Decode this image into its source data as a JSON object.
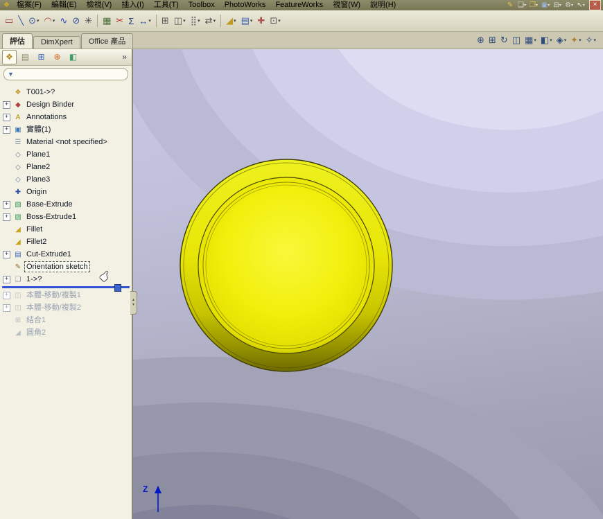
{
  "window": {
    "close_glyph": "×"
  },
  "menubar": {
    "app_icon": {
      "name": "app-icon",
      "glyph": "❖",
      "color": "#d8b020"
    },
    "items": [
      {
        "key": "file",
        "label": "檔案(F)"
      },
      {
        "key": "edit",
        "label": "編輯(E)"
      },
      {
        "key": "view",
        "label": "檢視(V)"
      },
      {
        "key": "insert",
        "label": "插入(I)"
      },
      {
        "key": "tools",
        "label": "工具(T)"
      },
      {
        "key": "toolbox",
        "label": "Toolbox"
      },
      {
        "key": "photoworks",
        "label": "PhotoWorks"
      },
      {
        "key": "featureworks",
        "label": "FeatureWorks"
      },
      {
        "key": "window",
        "label": "視窗(W)"
      },
      {
        "key": "help",
        "label": "說明(H)"
      }
    ],
    "quick_icons": [
      {
        "name": "edit-color-icon",
        "glyph": "✎",
        "color": "#e6c84a"
      },
      {
        "name": "new-document-icon",
        "glyph": "❏",
        "color": "#eceadc",
        "dropdown": true
      },
      {
        "name": "open-document-icon",
        "glyph": "❐",
        "color": "#e0c040",
        "dropdown": true
      },
      {
        "name": "save-icon",
        "glyph": "▣",
        "color": "#9db4e0",
        "dropdown": true
      },
      {
        "name": "print-icon",
        "glyph": "⊟",
        "color": "#dcdcd2",
        "dropdown": true
      },
      {
        "name": "options-icon",
        "glyph": "⚙",
        "color": "#dcdcd2",
        "dropdown": true
      },
      {
        "name": "select-tool-icon",
        "glyph": "↖",
        "color": "#eceadc",
        "dropdown": true
      }
    ]
  },
  "toolbar": {
    "icons": [
      {
        "name": "sketch-rectangle-icon",
        "glyph": "▭",
        "color": "#a23a2e"
      },
      {
        "name": "sketch-line-icon",
        "glyph": "╲",
        "color": "#32529e"
      },
      {
        "name": "sketch-circle-icon",
        "glyph": "⊙",
        "color": "#32529e",
        "dropdown": true
      },
      {
        "name": "sketch-arc-icon",
        "glyph": "◠",
        "color": "#a23a2e",
        "dropdown": true
      },
      {
        "name": "sketch-spline-icon",
        "glyph": "∿",
        "color": "#2545b8"
      },
      {
        "name": "sketch-ellipse-icon",
        "glyph": "⊘",
        "color": "#32529e"
      },
      {
        "name": "sketch-point-icon",
        "glyph": "✳",
        "color": "#404040"
      },
      {
        "sep": true
      },
      {
        "name": "convert-entities-icon",
        "glyph": "▦",
        "color": "#4a6a3a"
      },
      {
        "name": "trim-entities-icon",
        "glyph": "✂",
        "color": "#b02424"
      },
      {
        "name": "equations-icon",
        "glyph": "Σ",
        "color": "#1e3a78"
      },
      {
        "name": "smart-dimension-icon",
        "glyph": "↔",
        "color": "#32529e",
        "dropdown": true
      },
      {
        "sep": true
      },
      {
        "name": "offset-entities-icon",
        "glyph": "⊞",
        "color": "#555555"
      },
      {
        "name": "mirror-entities-icon",
        "glyph": "◫",
        "color": "#555555",
        "dropdown": true
      },
      {
        "name": "linear-pattern-icon",
        "glyph": "⣿",
        "color": "#666666",
        "dropdown": true
      },
      {
        "name": "move-entities-icon",
        "glyph": "⇄",
        "color": "#555555",
        "dropdown": true
      },
      {
        "sep": true
      },
      {
        "name": "sketch-fillet-icon",
        "glyph": "◢",
        "color": "#c09a20",
        "dropdown": true
      },
      {
        "name": "display-relations-icon",
        "glyph": "▤",
        "color": "#3a62b8",
        "dropdown": true
      },
      {
        "name": "repair-sketch-icon",
        "glyph": "✚",
        "color": "#b05050"
      },
      {
        "name": "grid-settings-icon",
        "glyph": "⊡",
        "color": "#555555",
        "dropdown": true
      }
    ]
  },
  "tabs": {
    "items": [
      {
        "key": "evaluate",
        "label": "評估",
        "active": true
      },
      {
        "key": "dimxpert",
        "label": "DimXpert"
      },
      {
        "key": "office-products",
        "label": "Office 產品"
      }
    ]
  },
  "headsup": {
    "icons": [
      {
        "name": "zoom-fit-icon",
        "glyph": "⊕",
        "color": "#2c4a7c"
      },
      {
        "name": "zoom-area-icon",
        "glyph": "⊞",
        "color": "#2c4a7c"
      },
      {
        "name": "previous-view-icon",
        "glyph": "↻",
        "color": "#2c4a7c"
      },
      {
        "name": "section-view-icon",
        "glyph": "◫",
        "color": "#2c4a7c"
      },
      {
        "name": "view-orientation-icon",
        "glyph": "▦",
        "color": "#2c4a7c",
        "dropdown": true
      },
      {
        "name": "display-style-icon",
        "glyph": "◧",
        "color": "#2c4a7c",
        "dropdown": true
      },
      {
        "name": "hide-show-items-icon",
        "glyph": "◈",
        "color": "#2c4a7c",
        "dropdown": true
      },
      {
        "name": "appearances-icon",
        "glyph": "✦",
        "color": "#b08030",
        "dropdown": true
      },
      {
        "name": "scene-icon",
        "glyph": "✧",
        "color": "#2c4a7c",
        "dropdown": true
      }
    ]
  },
  "panel": {
    "overflow_glyph": "»",
    "filter_glyph": "▼",
    "hand_glyph": "☛",
    "header_icons": [
      {
        "name": "featuremanager-tree-icon",
        "glyph": "❖",
        "color": "#b08820",
        "active": true
      },
      {
        "name": "propertymanager-icon",
        "glyph": "▤",
        "color": "#8a8a6a"
      },
      {
        "name": "configurationmanager-icon",
        "glyph": "⊞",
        "color": "#3a62b8"
      },
      {
        "name": "dimxpertmanager-icon",
        "glyph": "⊕",
        "color": "#d07020"
      },
      {
        "name": "displaymanager-icon",
        "glyph": "◧",
        "color": "#3a9a6a"
      }
    ],
    "tree": [
      {
        "key": "part-root",
        "label": "T001->?",
        "icon": "part-icon",
        "glyph": "❖",
        "color": "#c09020"
      },
      {
        "key": "design-binder",
        "label": "Design Binder",
        "icon": "design-binder-icon",
        "glyph": "◆",
        "color": "#b04040",
        "expand": true
      },
      {
        "key": "annotations",
        "label": "Annotations",
        "icon": "annotations-icon",
        "glyph": "A",
        "color": "#b08c00",
        "expand": true
      },
      {
        "key": "solid-bodies",
        "label": "實體(1)",
        "icon": "solid-bodies-folder-icon",
        "glyph": "▣",
        "color": "#3a7ab8",
        "expand": true
      },
      {
        "key": "material",
        "label": "Material <not specified>",
        "icon": "material-icon",
        "glyph": "☰",
        "color": "#7a8ca0"
      },
      {
        "key": "plane1",
        "label": "Plane1",
        "icon": "plane-icon",
        "glyph": "◇",
        "color": "#60788e"
      },
      {
        "key": "plane2",
        "label": "Plane2",
        "icon": "plane-icon",
        "glyph": "◇",
        "color": "#60788e"
      },
      {
        "key": "plane3",
        "label": "Plane3",
        "icon": "plane-icon",
        "glyph": "◇",
        "color": "#60788e"
      },
      {
        "key": "origin",
        "label": "Origin",
        "icon": "origin-icon",
        "glyph": "✚",
        "color": "#3050b0"
      },
      {
        "key": "base-extrude",
        "label": "Base-Extrude",
        "icon": "extrude-feature-icon",
        "glyph": "▧",
        "color": "#3a9a5a",
        "expand": true
      },
      {
        "key": "boss-extrude1",
        "label": "Boss-Extrude1",
        "icon": "extrude-feature-icon",
        "glyph": "▧",
        "color": "#3a9a5a",
        "expand": true
      },
      {
        "key": "fillet",
        "label": "Fillet",
        "icon": "fillet-feature-icon",
        "glyph": "◢",
        "color": "#c9a21d"
      },
      {
        "key": "fillet2",
        "label": "Fillet2",
        "icon": "fillet-feature-icon",
        "glyph": "◢",
        "color": "#c9a21d"
      },
      {
        "key": "cut-extrude1",
        "label": "Cut-Extrude1",
        "icon": "cut-extrude-feature-icon",
        "glyph": "▤",
        "color": "#3a62b8",
        "expand": true
      },
      {
        "key": "orientation-sketch",
        "label": "Orientation sketch",
        "icon": "sketch-icon",
        "glyph": "✎",
        "color": "#8a6a30",
        "selected": true
      },
      {
        "key": "derived-part",
        "label": "1->?",
        "icon": "derived-part-icon",
        "glyph": "❏",
        "color": "#8894a4",
        "expand": true,
        "rollback_after": true
      },
      {
        "key": "move-copy-body1",
        "label": "本體-移動/複製1",
        "icon": "move-copy-body-icon",
        "glyph": "◫",
        "color": "#8898a8",
        "expand": true,
        "grayed": true
      },
      {
        "key": "move-copy-body2",
        "label": "本體-移動/複製2",
        "icon": "move-copy-body-icon",
        "glyph": "◫",
        "color": "#8898a8",
        "expand": true,
        "grayed": true
      },
      {
        "key": "combine1",
        "label": "結合1",
        "icon": "combine-feature-icon",
        "glyph": "⊞",
        "color": "#8898a8",
        "grayed": true
      },
      {
        "key": "fillet-round2",
        "label": "圓角2",
        "icon": "fillet-feature-icon",
        "glyph": "◢",
        "color": "#8898a8",
        "grayed": true
      }
    ]
  },
  "viewport": {
    "triad_label": "Z",
    "part_colors": {
      "face": "#f2ef0c",
      "rim_dark": "#6e6b00",
      "edge": "#3f3d00"
    }
  }
}
